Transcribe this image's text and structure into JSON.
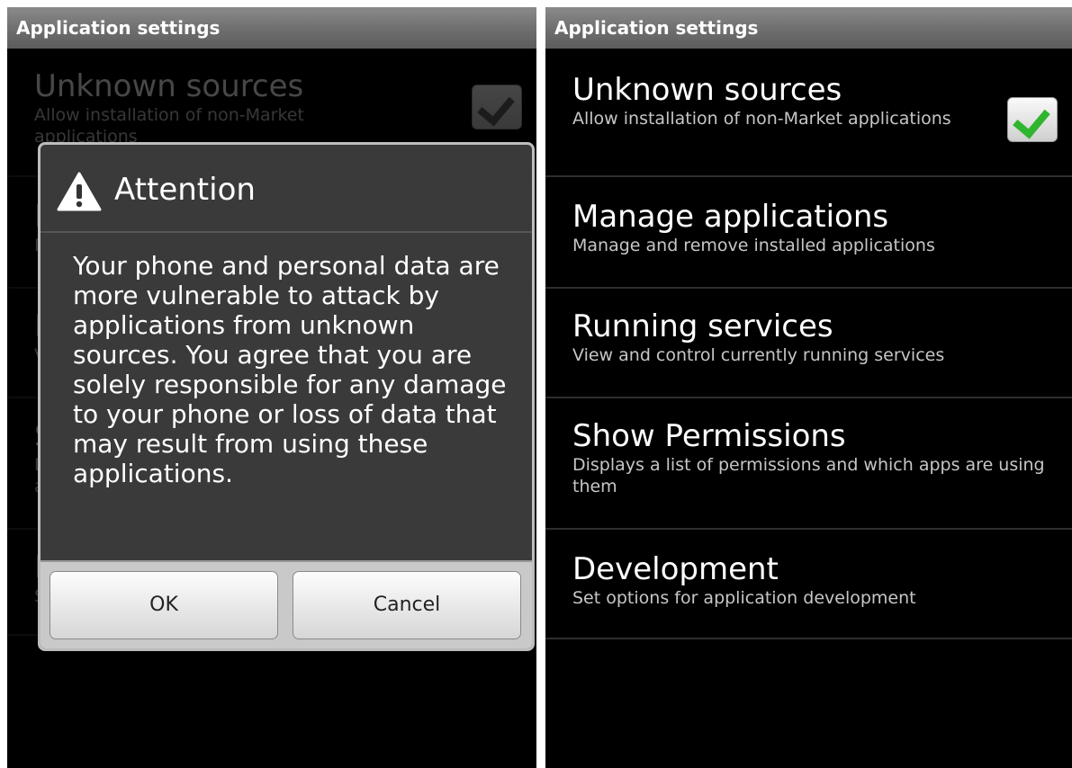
{
  "title": "Application settings",
  "settings": [
    {
      "title": "Unknown sources",
      "summary": "Allow installation of non-Market applications",
      "checked": true
    },
    {
      "title": "Manage applications",
      "summary": "Manage and remove installed applications"
    },
    {
      "title": "Running services",
      "summary": "View and control currently running services"
    },
    {
      "title": "Show Permissions",
      "summary": "Displays a list of permissions and which apps are using them"
    },
    {
      "title": "Development",
      "summary": "Set options for application development"
    }
  ],
  "dialog": {
    "icon": "warning-icon",
    "title": "Attention",
    "message": "Your phone and personal data are more vulnerable to attack by applications from unknown sources. You agree that you are solely responsible for any damage to your phone or loss of data that may result from using these applications.",
    "ok_label": "OK",
    "cancel_label": "Cancel"
  },
  "colors": {
    "checkmark": "#2fb52f",
    "titlebar": "#6e6e6e",
    "background": "#000000"
  }
}
